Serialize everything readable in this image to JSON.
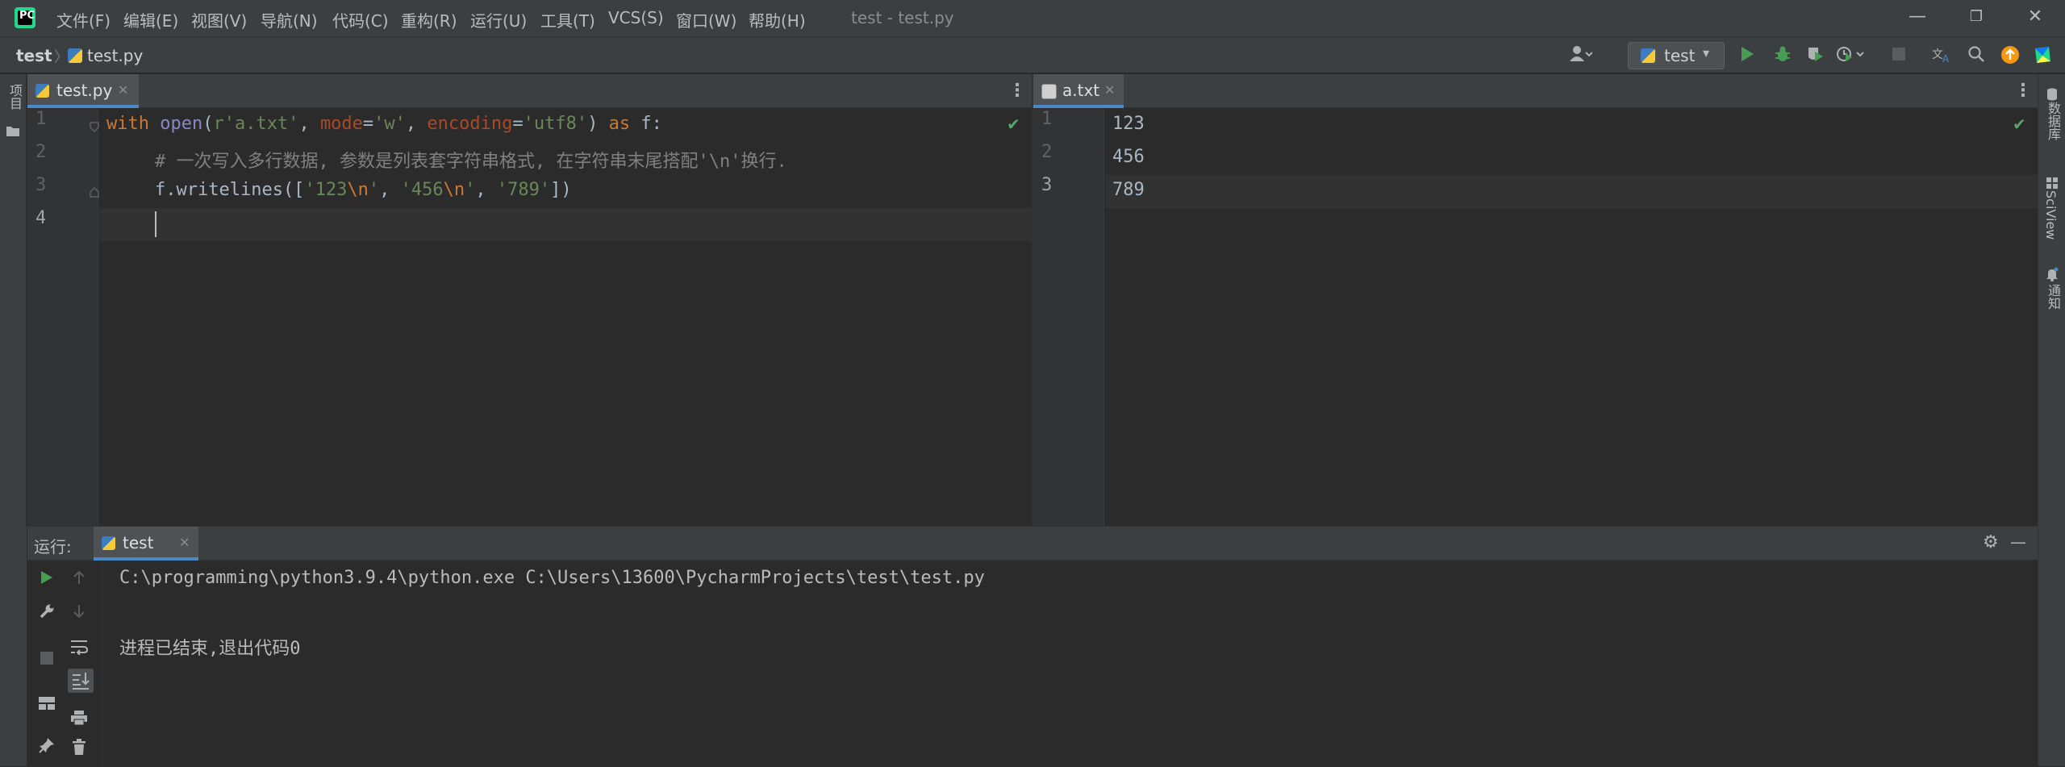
{
  "app": {
    "window_title": "test - test.py",
    "logo_text": "PC",
    "menu": [
      "文件(F)",
      "编辑(E)",
      "视图(V)",
      "导航(N)",
      "代码(C)",
      "重构(R)",
      "运行(U)",
      "工具(T)",
      "VCS(S)",
      "窗口(W)",
      "帮助(H)"
    ],
    "window_controls": {
      "minimize": "—",
      "restore": "❐",
      "close": "✕"
    }
  },
  "navbar": {
    "project": "test",
    "separator": "〉",
    "file": "test.py",
    "run_config": "test",
    "run_config_caret": "▾",
    "icons": [
      "user-icon",
      "run-icon",
      "debug-icon",
      "coverage-icon",
      "profile-icon",
      "stop-icon",
      "translate-icon",
      "search-icon",
      "update-icon",
      "plugin-icon"
    ]
  },
  "left_strip": {
    "project_label": "项目"
  },
  "right_strip": {
    "labels": [
      "数据库",
      "SciView",
      "通知"
    ]
  },
  "editor_left": {
    "tab": {
      "label": "test.py",
      "close": "✕"
    },
    "menu_icon": "⋮",
    "line_numbers": [
      "1",
      "2",
      "3",
      "4"
    ],
    "code": {
      "l1": {
        "kw_with": "with",
        "fn_open": "open",
        "p_open": "(",
        "str_r": "r'a.txt'",
        "comma1": ", ",
        "param_mode": "mode",
        "eq1": "=",
        "str_w": "'w'",
        "comma2": ", ",
        "param_enc": "encoding",
        "eq2": "=",
        "str_utf8": "'utf8'",
        "p_close": ") ",
        "kw_as": "as",
        "tail": " f:"
      },
      "l2": "# 一次写入多行数据, 参数是列表套字符串格式, 在字符串末尾搭配'\\n'换行.",
      "l3": {
        "pre": "f.writelines([",
        "s1a": "'123",
        "esc1": "\\n",
        "s1b": "'",
        "c1": ", ",
        "s2a": "'456",
        "esc2": "\\n",
        "s2b": "'",
        "c2": ", ",
        "s3": "'789'",
        "post": "])"
      }
    },
    "check": "✔"
  },
  "editor_right": {
    "tab": {
      "label": "a.txt",
      "close": "✕"
    },
    "menu_icon": "⋮",
    "line_numbers": [
      "1",
      "2",
      "3"
    ],
    "lines": [
      "123",
      "456",
      "789"
    ],
    "check": "✔"
  },
  "run_panel": {
    "title": "运行:",
    "tab": {
      "label": "test",
      "close": "✕"
    },
    "settings_icon": "⚙",
    "hide_icon": "—",
    "console": [
      "C:\\programming\\python3.9.4\\python.exe C:\\Users\\13600\\PycharmProjects\\test\\test.py",
      "",
      "进程已结束,退出代码0"
    ]
  }
}
